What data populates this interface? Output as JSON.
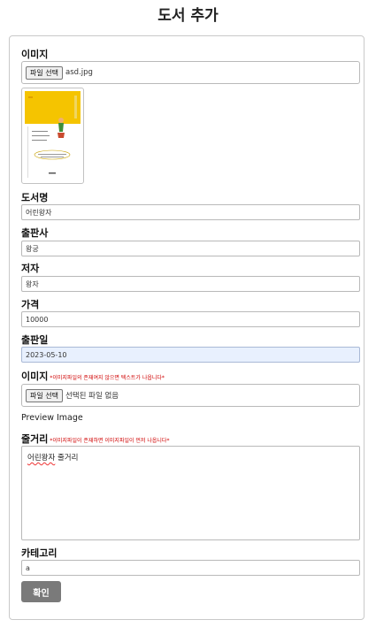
{
  "page_title": "도서 추가",
  "image_field": {
    "label": "이미지",
    "button_label": "파일 선택",
    "file_name": "asd.jpg"
  },
  "title_field": {
    "label": "도서명",
    "value": "어린왕자"
  },
  "publisher_field": {
    "label": "출판사",
    "value": "왕궁"
  },
  "author_field": {
    "label": "저자",
    "value": "왕자"
  },
  "price_field": {
    "label": "가격",
    "value": "10000"
  },
  "pubdate_field": {
    "label": "출판일",
    "value": "2023-05-10"
  },
  "image2_field": {
    "label": "이미지",
    "note": "*이미지파일의 존재여지 않으면 텍스트가 나옵니다*",
    "button_label": "파일 선택",
    "file_name": "선택된 파일 없음"
  },
  "preview_label": "Preview Image",
  "plot_field": {
    "label": "줄거리",
    "note": "*이미지파일이 존재하면 이미지파일이 먼저 나옵니다*",
    "value_part1": "어린왕자",
    "value_part2": " 줄거리"
  },
  "category_field": {
    "label": "카테고리",
    "value": "a"
  },
  "confirm_label": "확인",
  "colors": {
    "cover_yellow": "#f5c400",
    "confirm_button": "#7a7a7a",
    "note_red": "#d00000"
  }
}
